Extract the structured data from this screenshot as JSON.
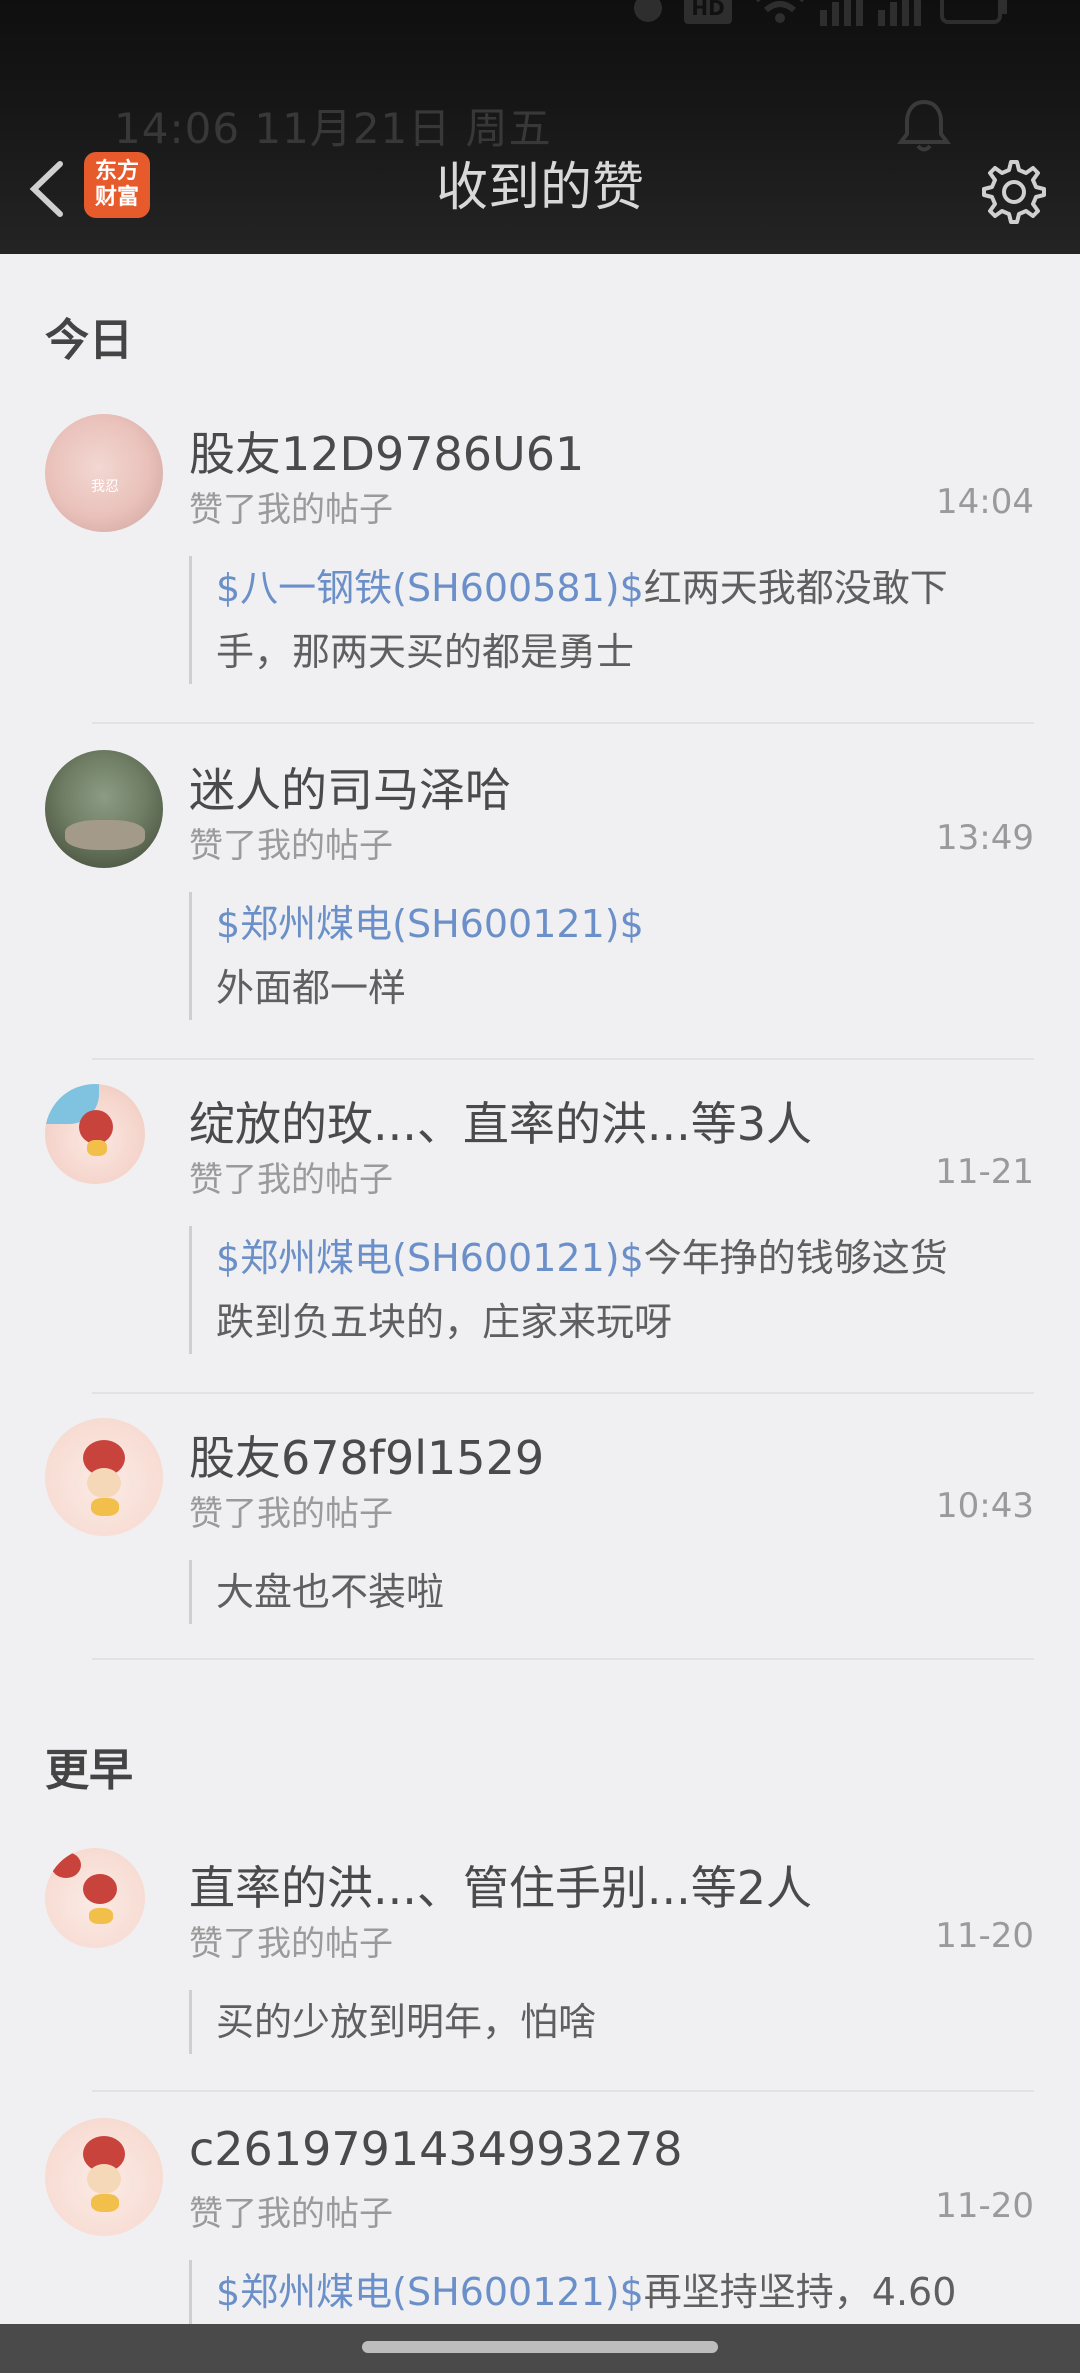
{
  "status": {
    "notification_line": "14:06   11月21日 周五",
    "hd_badge": "HD"
  },
  "header": {
    "logo_text_1": "东方",
    "logo_text_2": "财富",
    "title": "收到的赞"
  },
  "sections": {
    "today": "今日",
    "earlier": "更早"
  },
  "items": [
    {
      "name": "股友12D9786U61",
      "action": "赞了我的帖子",
      "time": "14:04",
      "stock": "$八一钢铁(SH600581)$",
      "text_1": "红两天我都没敢下",
      "text_2": "手，那两天买的都是勇士",
      "avatar_label": "我忍"
    },
    {
      "name": "迷人的司马泽哈",
      "action": "赞了我的帖子",
      "time": "13:49",
      "stock": "$郑州煤电(SH600121)$",
      "text_2": "外面都一样"
    },
    {
      "name": "绽放的玫...、直率的洪...等3人",
      "action": "赞了我的帖子",
      "time": "11-21",
      "stock": "$郑州煤电(SH600121)$",
      "text_1": "今年挣的钱够这货",
      "text_2": "跌到负五块的，庄家来玩呀"
    },
    {
      "name": "股友678f9l1529",
      "action": "赞了我的帖子",
      "time": "10:43",
      "text_2": "大盘也不装啦"
    },
    {
      "name": "直率的洪...、管住手别...等2人",
      "action": "赞了我的帖子",
      "time": "11-20",
      "text_2": "买的少放到明年，怕啥"
    },
    {
      "name": "c2619791434993278",
      "action": "赞了我的帖子",
      "time": "11-20",
      "stock": "$郑州煤电(SH600121)$",
      "text_1": "再坚持坚持，4.60"
    }
  ]
}
